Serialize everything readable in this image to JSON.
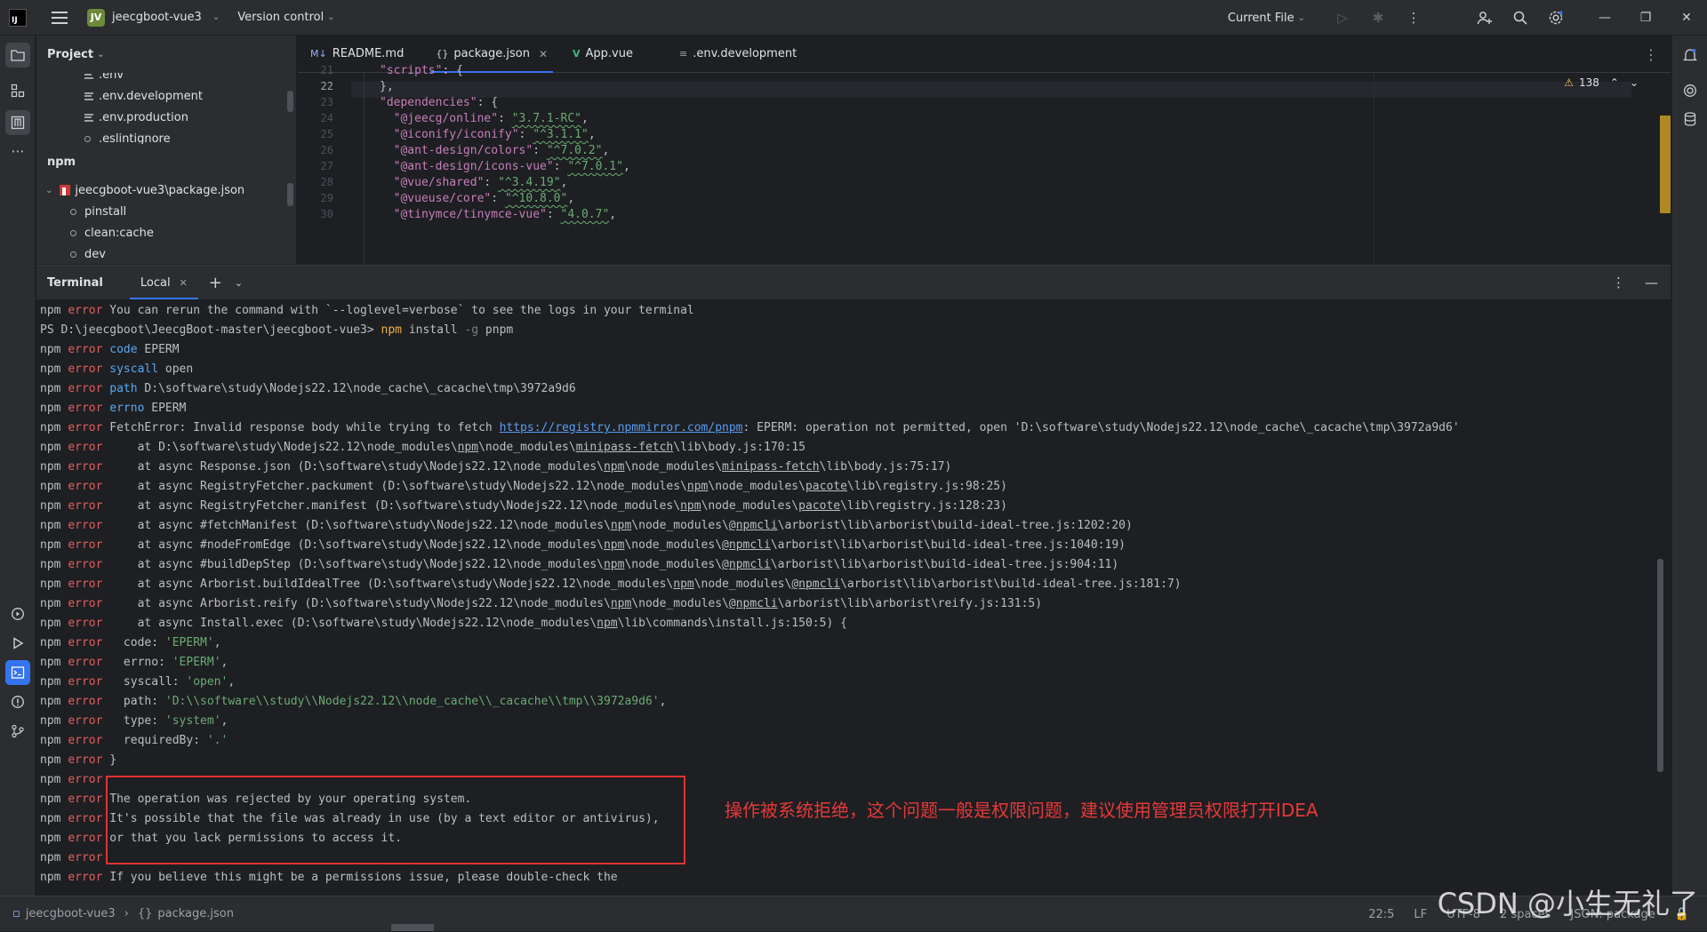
{
  "titlebar": {
    "logo_text": "IJ",
    "project_avatar": "JV",
    "project_name": "jeecgboot-vue3",
    "version_control": "Version control",
    "run_config": "Current File"
  },
  "project_panel": {
    "title": "Project",
    "files": [
      ".env",
      ".env.development",
      ".env.production",
      ".eslintignore"
    ],
    "npm_title": "npm",
    "npm_root": "jeecgboot-vue3\\package.json",
    "scripts": [
      "pinstall",
      "clean:cache",
      "dev"
    ]
  },
  "editor": {
    "tabs": [
      {
        "label": "README.md",
        "icon": "M↓"
      },
      {
        "label": "package.json",
        "icon": "{}"
      },
      {
        "label": "App.vue",
        "icon": "V"
      },
      {
        "label": ".env.development",
        "icon": "≡"
      }
    ],
    "warnings_count": "138",
    "line_numbers": [
      "21",
      "22",
      "23",
      "24",
      "25",
      "26",
      "27",
      "28",
      "29",
      "30"
    ],
    "lines": [
      {
        "key": "\"scripts\"",
        "rest": ": {"
      },
      {
        "key": "",
        "rest": "},"
      },
      {
        "key": "\"dependencies\"",
        "rest": ": {"
      },
      {
        "key": "\"@jeecg/online\"",
        "val": "\"3.7.1-RC\""
      },
      {
        "key": "\"@iconify/iconify\"",
        "val": "\"^3.1.1\""
      },
      {
        "key": "\"@ant-design/colors\"",
        "val": "\"^7.0.2\""
      },
      {
        "key": "\"@ant-design/icons-vue\"",
        "val": "\"^7.0.1\""
      },
      {
        "key": "\"@vue/shared\"",
        "val": "\"^3.4.19\""
      },
      {
        "key": "\"@vueuse/core\"",
        "val": "\"^10.8.0\""
      },
      {
        "key": "\"@tinymce/tinymce-vue\"",
        "val": "\"4.0.7\""
      }
    ]
  },
  "terminal": {
    "title": "Terminal",
    "tab_label": "Local",
    "annotation": "操作被系统拒绝，这个问题一般是权限问题，建议使用管理员权限打开IDEA",
    "lines": [
      "npm error You can rerun the command with `--loglevel=verbose` to see the logs in your terminal",
      "PS D:\\jeecgboot\\JeecgBoot-master\\jeecgboot-vue3> npm install -g pnpm",
      "npm error code EPERM",
      "npm error syscall open",
      "npm error path D:\\software\\study\\Nodejs22.12\\node_cache\\_cacache\\tmp\\3972a9d6",
      "npm error errno EPERM",
      "npm error FetchError: Invalid response body while trying to fetch https://registry.npmmirror.com/pnpm: EPERM: operation not permitted, open 'D:\\software\\study\\Nodejs22.12\\node_cache\\_cacache\\tmp\\3972a9d6'",
      "npm error     at D:\\software\\study\\Nodejs22.12\\node_modules\\npm\\node_modules\\minipass-fetch\\lib\\body.js:170:15",
      "npm error     at async Response.json (D:\\software\\study\\Nodejs22.12\\node_modules\\npm\\node_modules\\minipass-fetch\\lib\\body.js:75:17)",
      "npm error     at async RegistryFetcher.packument (D:\\software\\study\\Nodejs22.12\\node_modules\\npm\\node_modules\\pacote\\lib\\registry.js:98:25)",
      "npm error     at async RegistryFetcher.manifest (D:\\software\\study\\Nodejs22.12\\node_modules\\npm\\node_modules\\pacote\\lib\\registry.js:128:23)",
      "npm error     at async #fetchManifest (D:\\software\\study\\Nodejs22.12\\node_modules\\npm\\node_modules\\@npmcli\\arborist\\lib\\arborist\\build-ideal-tree.js:1202:20)",
      "npm error     at async #nodeFromEdge (D:\\software\\study\\Nodejs22.12\\node_modules\\npm\\node_modules\\@npmcli\\arborist\\lib\\arborist\\build-ideal-tree.js:1040:19)",
      "npm error     at async #buildDepStep (D:\\software\\study\\Nodejs22.12\\node_modules\\npm\\node_modules\\@npmcli\\arborist\\lib\\arborist\\build-ideal-tree.js:904:11)",
      "npm error     at async Arborist.buildIdealTree (D:\\software\\study\\Nodejs22.12\\node_modules\\npm\\node_modules\\@npmcli\\arborist\\lib\\arborist\\build-ideal-tree.js:181:7)",
      "npm error     at async Arborist.reify (D:\\software\\study\\Nodejs22.12\\node_modules\\npm\\node_modules\\@npmcli\\arborist\\lib\\arborist\\reify.js:131:5)",
      "npm error     at async Install.exec (D:\\software\\study\\Nodejs22.12\\node_modules\\npm\\lib\\commands\\install.js:150:5) {",
      "npm error   code: 'EPERM',",
      "npm error   errno: 'EPERM',",
      "npm error   syscall: 'open',",
      "npm error   path: 'D:\\\\software\\\\study\\\\Nodejs22.12\\\\node_cache\\\\_cacache\\\\tmp\\\\3972a9d6',",
      "npm error   type: 'system',",
      "npm error   requiredBy: '.'",
      "npm error }",
      "npm error",
      "npm error The operation was rejected by your operating system.",
      "npm error It's possible that the file was already in use (by a text editor or antivirus),",
      "npm error or that you lack permissions to access it.",
      "npm error",
      "npm error If you believe this might be a permissions issue, please double-check the"
    ]
  },
  "statusbar": {
    "crumb_project": "jeecgboot-vue3",
    "crumb_file": "package.json",
    "position": "22:5",
    "line_sep": "LF",
    "encoding": "UTF-8",
    "indent": "2 spaces",
    "schema": "JSON: package"
  },
  "watermark": "CSDN @小生无礼了"
}
